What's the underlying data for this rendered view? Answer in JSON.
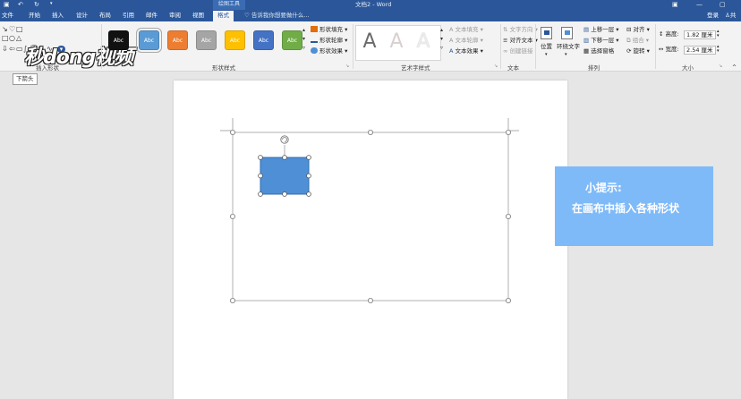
{
  "titlebar": {
    "contextual_group": "绘图工具",
    "document_title": "文档2 - Word",
    "login": "登录",
    "share": "共"
  },
  "tabs": [
    {
      "label": "文件"
    },
    {
      "label": "开始"
    },
    {
      "label": "插入"
    },
    {
      "label": "设计"
    },
    {
      "label": "布局"
    },
    {
      "label": "引用"
    },
    {
      "label": "邮件"
    },
    {
      "label": "审阅"
    },
    {
      "label": "视图"
    },
    {
      "label": "格式",
      "active": true
    }
  ],
  "tellme": "告诉我你想要做什么...",
  "watermark": "秒dong视频",
  "groups": {
    "insert_shapes": "插入形状",
    "shape_styles": "形状样式",
    "wordart_styles": "艺术字样式",
    "text": "文本",
    "arrange": "排列",
    "size": "大小"
  },
  "shape_style_swatches": [
    {
      "label": "Abc",
      "color": "#111111"
    },
    {
      "label": "Abc",
      "color": "#5b9bd5"
    },
    {
      "label": "Abc",
      "color": "#ed7d31"
    },
    {
      "label": "Abc",
      "color": "#a5a5a5"
    },
    {
      "label": "Abc",
      "color": "#ffc000"
    },
    {
      "label": "Abc",
      "color": "#4472c4"
    },
    {
      "label": "Abc",
      "color": "#70ad47"
    }
  ],
  "shape_commands": {
    "fill": "形状填充",
    "outline": "形状轮廓",
    "effects": "形状效果"
  },
  "wordart": {
    "sample": "A",
    "fill": "文本填充",
    "outline": "文本轮廓",
    "effects": "文本效果"
  },
  "text_commands": {
    "direction": "文字方向",
    "align": "对齐文本",
    "link": "创建链接"
  },
  "arrange_commands": {
    "position": "位置",
    "wrap": "环绕文字",
    "bring_forward": "上移一层",
    "send_backward": "下移一层",
    "selection_pane": "选择窗格",
    "align": "对齐",
    "group": "组合",
    "rotate": "旋转"
  },
  "size": {
    "height_label": "高度:",
    "height_value": "1.82 厘米",
    "width_label": "宽度:",
    "width_value": "2.54 厘米"
  },
  "tooltip": "下箭头",
  "tip": {
    "title": "小提示:",
    "text": "在画布中插入各种形状"
  },
  "colors": {
    "ribbon_blue": "#2b579a",
    "shape_fill": "#4f8fd6",
    "shape_border": "#2f6cb0",
    "tip_bg": "#7fbaf8"
  }
}
